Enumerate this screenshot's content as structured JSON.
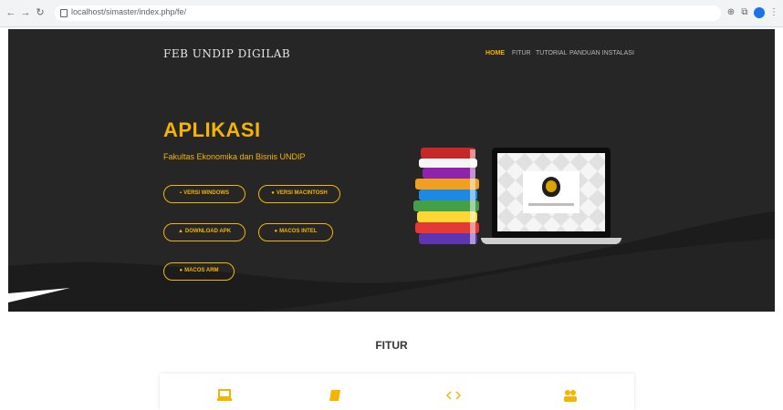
{
  "browser": {
    "url": "localhost/simaster/index.php/fe/",
    "icons": [
      "back-icon",
      "forward-icon",
      "reload-icon",
      "lock-icon",
      "zoom-icon",
      "extension-icon",
      "profile-icon",
      "menu-icon"
    ]
  },
  "header": {
    "logo_text": "FEB UNDIP DIGILAB",
    "nav": [
      {
        "label": "HOME",
        "active": true
      },
      {
        "label": "FITUR",
        "active": false
      },
      {
        "label": "TUTORIAL",
        "active": false
      },
      {
        "label": "PANDUAN INSTALASI",
        "active": false
      }
    ]
  },
  "hero": {
    "title": "APLIKASI",
    "subtitle": "Fakultas Ekonomika dan Bisnis UNDIP",
    "buttons": [
      {
        "label": "VERSI WINDOWS",
        "icon": "windows-icon"
      },
      {
        "label": "VERSI MACINTOSH",
        "icon": "apple-icon"
      },
      {
        "label": "DOWNLOAD APK",
        "icon": "android-icon"
      },
      {
        "label": "MACOS INTEL",
        "icon": "apple-icon"
      },
      {
        "label": "MACOS ARM",
        "icon": "apple-icon"
      }
    ]
  },
  "fitur": {
    "title": "FITUR",
    "icons": [
      "laptop-icon",
      "book-icon",
      "code-icon",
      "users-icon"
    ]
  },
  "colors": {
    "accent": "#f5b400",
    "hero_bg": "#262626"
  }
}
